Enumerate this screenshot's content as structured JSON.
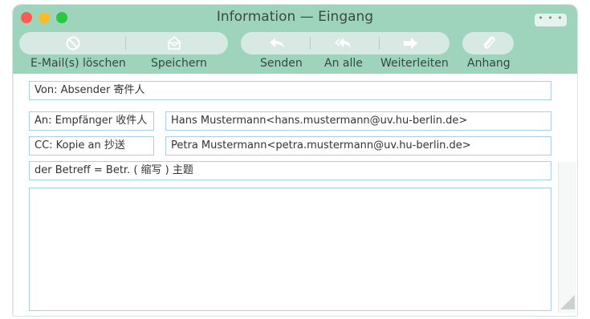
{
  "window": {
    "title": "Information — Eingang",
    "more_label": "• • •"
  },
  "toolbar": {
    "delete_label": "E-Mail(s) löschen",
    "save_label": "Speichern",
    "send_label": "Senden",
    "reply_all_label": "An alle",
    "forward_label": "Weiterleiten",
    "attach_label": "Anhang"
  },
  "fields": {
    "from": "Von: Absender 寄件人",
    "to_label": "An: Empfänger 收件人",
    "to_value": "Hans Mustermann<hans.mustermann@uv.hu-berlin.de>",
    "cc_label": "CC: Kopie an 抄送",
    "cc_value": "Petra Mustermann<petra.mustermann@uv.hu-berlin.de>",
    "subject": "der Betreff = Betr. ( 缩写 ) 主题",
    "body": ""
  },
  "colors": {
    "toolbar_bg": "#9dd4bb",
    "button_bg": "#d8e8e2",
    "field_border": "#a8d0e6",
    "close": "#fe5b52",
    "minimize": "#f6bc2c",
    "zoom": "#27c93f"
  },
  "icons": {
    "delete": "no-entry-icon",
    "save": "envelope-icon",
    "send": "reply-arrow-icon",
    "reply_all": "reply-all-icon",
    "forward": "forward-arrow-icon",
    "attach": "paperclip-icon"
  }
}
